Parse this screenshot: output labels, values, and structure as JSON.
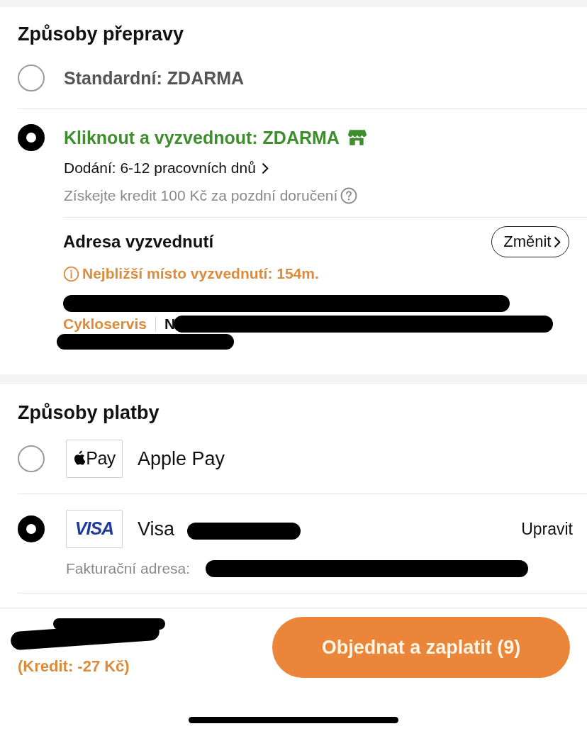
{
  "shipping": {
    "title": "Způsoby přepravy",
    "options": [
      {
        "label": "Standardní: ZDARMA",
        "selected": false
      },
      {
        "label": "Kliknout a vyzvednout: ZDARMA",
        "selected": true,
        "delivery": "Dodání: 6-12 pracovních dnů",
        "credit_note": "Získejte kredit 100 Kč za pozdní doručení",
        "pickup": {
          "title": "Adresa vyzvednutí",
          "change_button": "Změnit",
          "nearest": "Nejbližší místo vyzvednutí: 154m.",
          "store": "Cykloservis",
          "address": "N",
          "redacted": true
        }
      }
    ]
  },
  "payment": {
    "title": "Způsoby platby",
    "methods": [
      {
        "kind": "applepay",
        "logo": "Pay",
        "label": "Apple Pay",
        "selected": false
      },
      {
        "kind": "visa",
        "logo": "VISA",
        "label": "Visa",
        "selected": true,
        "action": "Upravit",
        "billing": "Fakturační adresa:",
        "redacted": true
      }
    ]
  },
  "footer": {
    "total_redacted": true,
    "credit": "(Kredit: -27 Kč)",
    "order_button": "Objednat a zaplatit (9)"
  }
}
